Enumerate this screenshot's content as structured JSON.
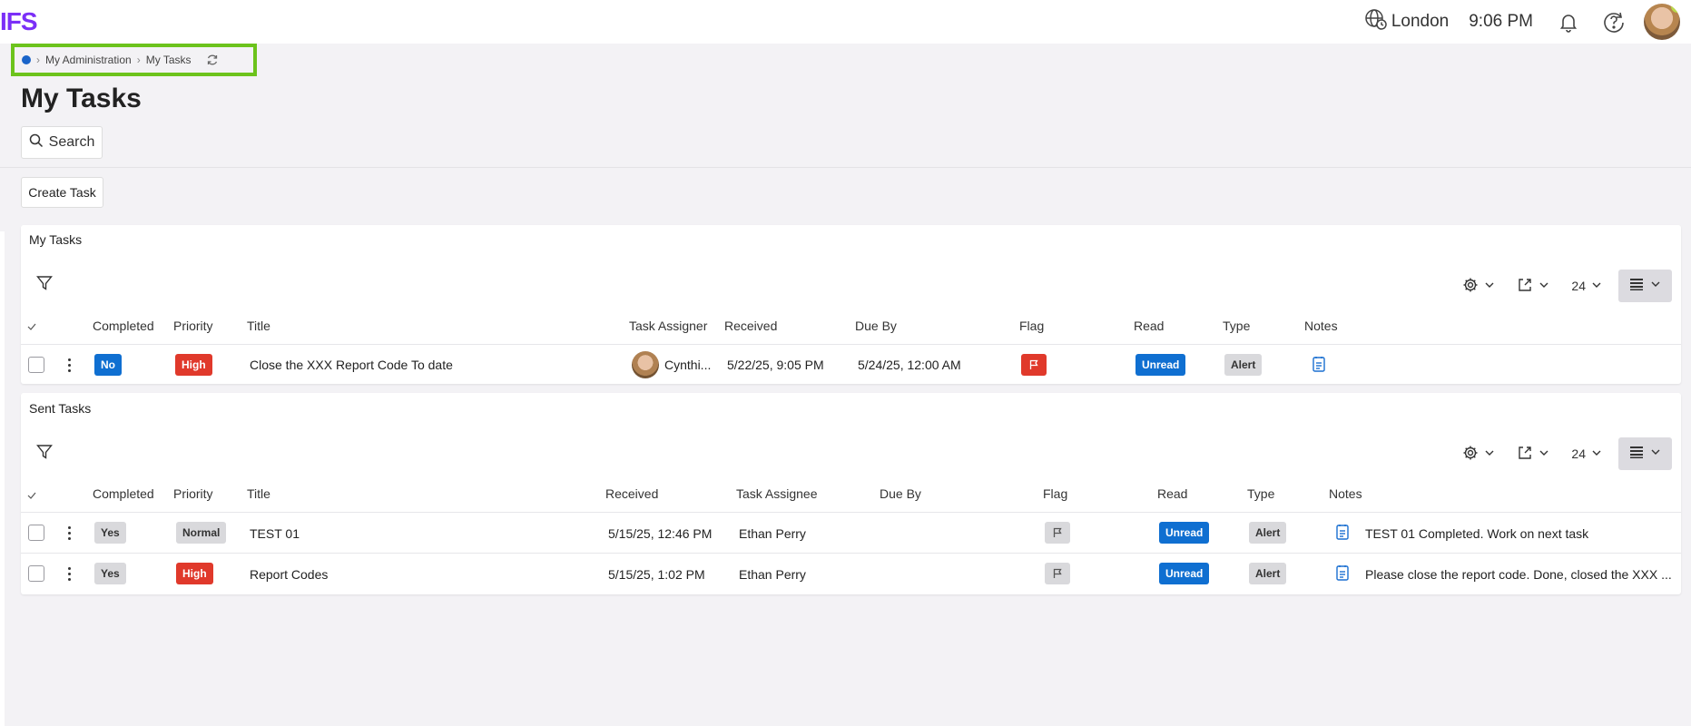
{
  "app": {
    "logo": "IFS"
  },
  "header": {
    "location": "London",
    "time": "9:06 PM"
  },
  "breadcrumb": {
    "items": [
      "My Administration",
      "My Tasks"
    ]
  },
  "page": {
    "title": "My Tasks",
    "search_label": "Search",
    "create_label": "Create Task"
  },
  "my_tasks": {
    "title": "My Tasks",
    "page_size": "24",
    "columns": [
      "Completed",
      "Priority",
      "Title",
      "Task Assigner",
      "Received",
      "Due By",
      "Flag",
      "Read",
      "Type",
      "Notes"
    ],
    "rows": [
      {
        "completed": "No",
        "priority": "High",
        "title": "Close the XXX Report Code To date",
        "assigner": "Cynthi...",
        "received": "5/22/25, 9:05 PM",
        "due_by": "5/24/25, 12:00 AM",
        "flag": "red-flag",
        "read": "Unread",
        "type": "Alert",
        "notes": ""
      }
    ]
  },
  "sent_tasks": {
    "title": "Sent Tasks",
    "page_size": "24",
    "columns": [
      "Completed",
      "Priority",
      "Title",
      "Received",
      "Task Assignee",
      "Due By",
      "Flag",
      "Read",
      "Type",
      "Notes"
    ],
    "rows": [
      {
        "completed": "Yes",
        "priority": "Normal",
        "title": "TEST 01",
        "received": "5/15/25, 12:46 PM",
        "assignee": "Ethan Perry",
        "due_by": "",
        "flag": "grey-flag",
        "read": "Unread",
        "type": "Alert",
        "notes": "TEST 01 Completed. Work on next task"
      },
      {
        "completed": "Yes",
        "priority": "High",
        "title": "Report Codes",
        "received": "5/15/25, 1:02 PM",
        "assignee": "Ethan Perry",
        "due_by": "",
        "flag": "grey-flag",
        "read": "Unread",
        "type": "Alert",
        "notes": "Please close the report code. Done, closed the XXX ..."
      }
    ]
  },
  "colors": {
    "accent": "#7b2ff7",
    "badge_blue": "#0f6fd1",
    "badge_red": "#e0392b",
    "badge_grey": "#d9d9dc",
    "breadcrumb_highlight": "#6cc31c"
  }
}
